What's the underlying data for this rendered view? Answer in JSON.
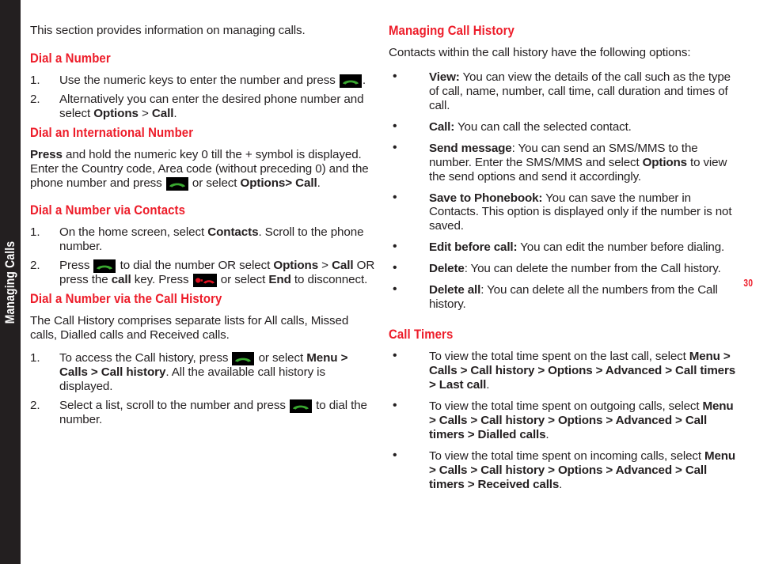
{
  "page": {
    "side_tab_label": "Managing Calls",
    "page_number": "30",
    "accent_red": "#ed1c29",
    "tab_black": "#231f20",
    "text_black": "#231f20"
  },
  "icons": {
    "call_key": "green-call-handset-icon",
    "end_key": "red-end-call-handset-icon"
  },
  "left_column": {
    "intro": "This section provides information on managing calls.",
    "sections": [
      {
        "heading": "Dial a Number",
        "items": [
          {
            "num": "1.",
            "text_before": "Use the numeric keys to enter the number and press",
            "icon": "call_key",
            "text_after": "."
          },
          {
            "num": "2.",
            "text_a": "Alternatively you can enter the desired phone number and select ",
            "bold_a": "Options",
            "mid": " > ",
            "bold_b": "Call",
            "tail": "."
          }
        ]
      },
      {
        "heading": "Dial an International Number",
        "paragraph": {
          "bold_lead": "Press",
          "text_1": " and hold the numeric key 0 till the + symbol is displayed. Enter the Country code, Area code (without preceding 0) and the phone number and press ",
          "icon": "call_key",
          "text_2": " or select ",
          "bold_2": "Options> Call",
          "tail": "."
        }
      },
      {
        "heading": "Dial a Number via Contacts",
        "items": [
          {
            "num": "1.",
            "text_a": "On the home screen, select ",
            "bold_a": "Contacts",
            "text_b": ". Scroll to the phone number."
          },
          {
            "num": "2.",
            "text_a": "Press ",
            "icon_a": "call_key",
            "text_b": " to dial the number OR select ",
            "bold_a": "Options",
            "text_c": " > ",
            "bold_b": "Call",
            "text_d": " OR press the ",
            "bold_c": "call",
            "text_e": " key. Press ",
            "icon_b": "end_key",
            "text_f": " or select ",
            "bold_d": "End",
            "text_g": " to disconnect."
          }
        ]
      },
      {
        "heading": "Dial a Number via the Call History",
        "paragraph": "The Call History comprises separate lists for All calls, Missed calls, Dialled calls and Received calls.",
        "items": [
          {
            "num": "1.",
            "text_a": "To access the Call history, press ",
            "icon_a": "call_key",
            "text_b": " or select ",
            "bold_a": "Menu > Calls > Call history",
            "text_c": ". All the available call history is displayed."
          },
          {
            "num": "2.",
            "text_a": "Select a list, scroll to the number and press ",
            "icon_a": "call_key",
            "text_b": " to dial the number."
          }
        ]
      }
    ]
  },
  "right_column": {
    "sections": [
      {
        "heading": "Managing Call History",
        "paragraph": "Contacts within the call history have the following options:",
        "bullets": [
          {
            "bold": "View:",
            "text": " You can view the details of the call such as the type of call, name, number, call time, call duration and times of call."
          },
          {
            "bold": "Call:",
            "text": " You can call the selected contact."
          },
          {
            "bold": "Send message",
            "text": ": You can send an SMS/MMS to the number. Enter the SMS/MMS and select ",
            "bold_2": "Options",
            "text_2": " to view the send options and send it accordingly."
          },
          {
            "bold": "Save to Phonebook:",
            "text": " You can save the number in Contacts. This option is displayed only if the number is not saved."
          },
          {
            "bold": "Edit before call:",
            "text": " You can edit the number before dialing."
          },
          {
            "bold": "Delete",
            "text": ": You can delete the number from the Call history."
          },
          {
            "bold": "Delete all",
            "text": ": You can delete all the numbers from the Call history."
          }
        ]
      },
      {
        "heading": "Call Timers",
        "bullets": [
          {
            "text": "To view the total time spent on the last call, select ",
            "bold": "Menu > Calls > Call history > Options > Advanced > Call timers > Last call",
            "tail": "."
          },
          {
            "text": "To view the total time spent on outgoing calls, select ",
            "bold": "Menu > Calls > Call history > Options > Advanced > Call timers > Dialled calls",
            "tail": "."
          },
          {
            "text": "To view the total time spent on incoming calls, select ",
            "bold": "Menu > Calls > Call history > Options > Advanced > Call timers > Received calls",
            "tail": "."
          }
        ]
      }
    ]
  }
}
